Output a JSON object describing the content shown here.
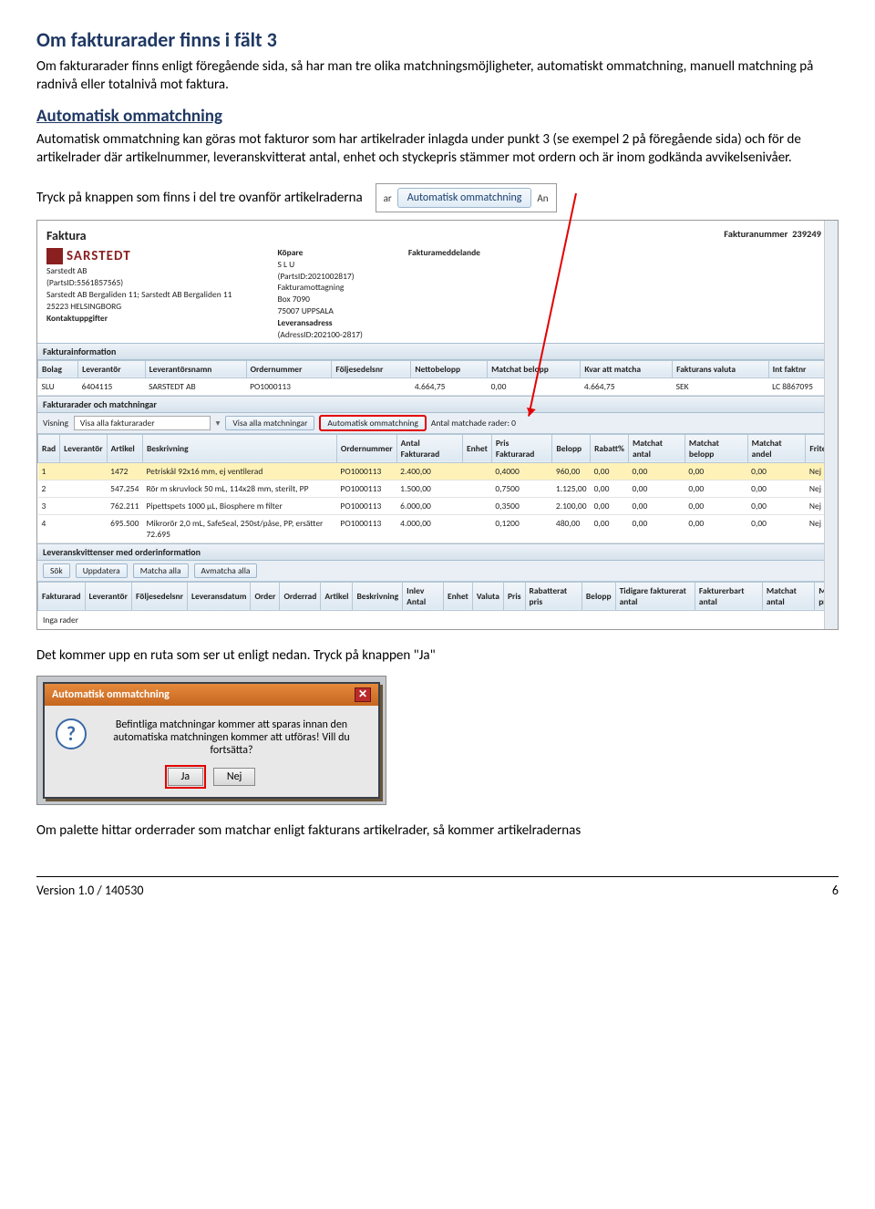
{
  "doc": {
    "title": "Om fakturarader finns i fält 3",
    "intro": "Om fakturarader finns enligt föregående sida, så har man tre olika matchningsmöjligheter, automatiskt ommatchning, manuell matchning på radnivå eller totalnivå mot faktura.",
    "sub1_title": "Automatisk ommatchning",
    "sub1_body": "Automatisk ommatchning kan göras mot fakturor som har artikelrader inlagda under punkt 3 (se exempel 2 på föregående sida) och för de artikelrader där artikelnummer, leveranskvitterat antal, enhet och styckepris stämmer mot ordern och är inom godkända avvikelsenivåer.",
    "press_btn": "Tryck på knappen som finns i del tre ovanför artikelraderna",
    "snippet_btn": "Automatisk ommatchning",
    "snippet_left": "ar",
    "snippet_right": "An",
    "post_shot": "Det kommer upp en ruta som ser ut enligt nedan. Tryck på knappen \"Ja\"",
    "after_dialog": "Om palette hittar orderrader som matchar enligt fakturans artikelrader, så kommer artikelradernas"
  },
  "shot": {
    "faktura_label": "Faktura",
    "brand": "SARSTEDT",
    "seller": [
      "Sarstedt AB",
      "(PartsID:5561857565)",
      "Sarstedt AB Bergaliden 11; Sarstedt AB Bergaliden 11",
      "25223 HELSINGBORG",
      "Kontaktuppgifter"
    ],
    "buyer_label": "Köpare",
    "buyer": [
      "S L U",
      "(PartsID:2021002817)",
      "Fakturamottagning",
      "Box 7090",
      "75007 UPPSALA",
      "Leveransadress",
      "(AdressID:202100-2817)"
    ],
    "meddelande": "Fakturameddelande",
    "faknr_label": "Fakturanummer",
    "faknr": "239249",
    "sec1": "Fakturainformation",
    "info_headers": [
      "Bolag",
      "Leverantör",
      "Leverantörsnamn",
      "Ordernummer",
      "Följesedelsnr",
      "Nettobelopp",
      "Matchat belopp",
      "Kvar att matcha",
      "Fakturans valuta",
      "Int faktnr"
    ],
    "info_row": [
      "SLU",
      "6404115",
      "SARSTEDT AB",
      "PO1000113",
      "",
      "4.664,75",
      "0,00",
      "4.664,75",
      "SEK",
      "LC 8867095"
    ],
    "sec2": "Fakturarader och matchningar",
    "visning": "Visning",
    "visa_alla": "Visa alla fakturarader",
    "btn_visa_match": "Visa alla matchningar",
    "btn_auto": "Automatisk ommatchning",
    "matched_label": "Antal matchade rader: 0",
    "row_headers": [
      "Rad",
      "Leverantör",
      "Artikel",
      "Beskrivning",
      "Ordernummer",
      "Antal Fakturarad",
      "Enhet",
      "Pris Fakturarad",
      "Belopp",
      "Rabatt%",
      "Matchat antal",
      "Matchat belopp",
      "Matchat andel",
      "Fritext"
    ],
    "rows": [
      [
        "1",
        "",
        "1472",
        "Petriskål 92x16 mm, ej ventilerad",
        "PO1000113",
        "2.400,00",
        "",
        "0,4000",
        "960,00",
        "0,00",
        "0,00",
        "0,00",
        "0,00",
        "Nej"
      ],
      [
        "2",
        "",
        "547.254",
        "Rör m skruvlock 50 mL, 114x28 mm, sterilt, PP",
        "PO1000113",
        "1.500,00",
        "",
        "0,7500",
        "1.125,00",
        "0,00",
        "0,00",
        "0,00",
        "0,00",
        "Nej"
      ],
      [
        "3",
        "",
        "762.211",
        "Pipettspets 1000 µL, Biosphere m filter",
        "PO1000113",
        "6.000,00",
        "",
        "0,3500",
        "2.100,00",
        "0,00",
        "0,00",
        "0,00",
        "0,00",
        "Nej"
      ],
      [
        "4",
        "",
        "695.500",
        "Mikrorör 2,0 mL, SafeSeal, 250st/påse, PP, ersätter 72.695",
        "PO1000113",
        "4.000,00",
        "",
        "0,1200",
        "480,00",
        "0,00",
        "0,00",
        "0,00",
        "0,00",
        "Nej"
      ]
    ],
    "sec3": "Leveranskvittenser med orderinformation",
    "btns3": [
      "Sök",
      "Uppdatera",
      "Matcha alla",
      "Avmatcha alla"
    ],
    "lk_headers": [
      "Fakturarad",
      "Leverantör",
      "Följesedelsnr",
      "Leveransdatum",
      "Order",
      "Orderrad",
      "Artikel",
      "Beskrivning",
      "Inlev Antal",
      "Enhet",
      "Valuta",
      "Pris",
      "Rabatterat pris",
      "Belopp",
      "Tidigare fakturerat antal",
      "Fakturerbart antal",
      "Matchat antal",
      "M pr"
    ],
    "inga": "Inga rader"
  },
  "dialog": {
    "title": "Automatisk ommatchning",
    "body": "Befintliga matchningar kommer att sparas innan den automatiska matchningen kommer att utföras! Vill du fortsätta?",
    "ja": "Ja",
    "nej": "Nej"
  },
  "footer": {
    "version": "Version 1.0 / 140530",
    "page": "6"
  }
}
